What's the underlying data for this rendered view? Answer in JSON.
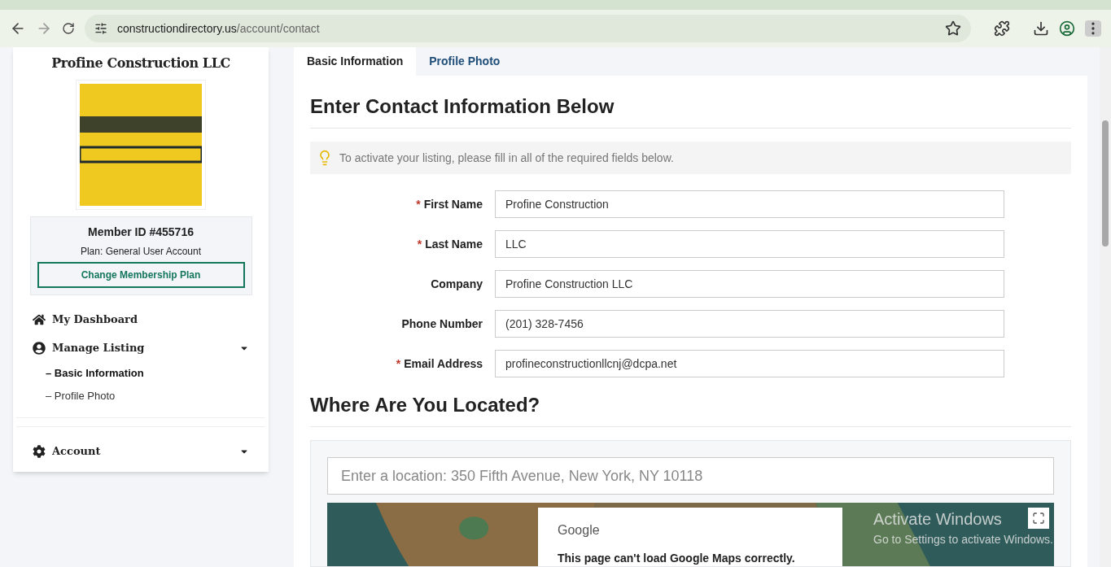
{
  "browser": {
    "url_host": "constructiondirectory.us",
    "url_path": "/account/contact"
  },
  "sidebar": {
    "company": "Profine Construction LLC",
    "member_id": "Member ID #455716",
    "plan": "Plan: General User Account",
    "change_plan_button": "Change Membership Plan",
    "nav": [
      {
        "label": "My Dashboard",
        "has_caret": false
      },
      {
        "label": "Manage Listing",
        "has_caret": true,
        "children": [
          {
            "label": "– Basic Information",
            "selected": true
          },
          {
            "label": "– Profile Photo",
            "selected": false
          }
        ]
      },
      {
        "label": "Account",
        "has_caret": true
      }
    ]
  },
  "tabs": [
    {
      "label": "Basic Information",
      "selected": true
    },
    {
      "label": "Profile Photo",
      "selected": false
    }
  ],
  "heading": "Enter Contact Information Below",
  "notice": "To activate your listing, please fill in all of the required fields below.",
  "fields": [
    {
      "label": "First Name",
      "required": true,
      "value": "Profine Construction"
    },
    {
      "label": "Last Name",
      "required": true,
      "value": "LLC"
    },
    {
      "label": "Company",
      "required": false,
      "value": "Profine Construction LLC"
    },
    {
      "label": "Phone Number",
      "required": false,
      "value": "(201) 328-7456"
    },
    {
      "label": "Email Address",
      "required": true,
      "value": "profineconstructionllcnj@dcpa.net"
    }
  ],
  "required_mark": "*",
  "location_heading": "Where Are You Located?",
  "location_placeholder": "Enter a location: 350 Fifth Avenue, New York, NY 10118",
  "map": {
    "kind": "picture",
    "dialog_title": "Google",
    "dialog_message": "This page can't load Google Maps correctly."
  },
  "os_overlay": {
    "title": "Activate Windows",
    "subtitle": "Go to Settings to activate Windows."
  }
}
